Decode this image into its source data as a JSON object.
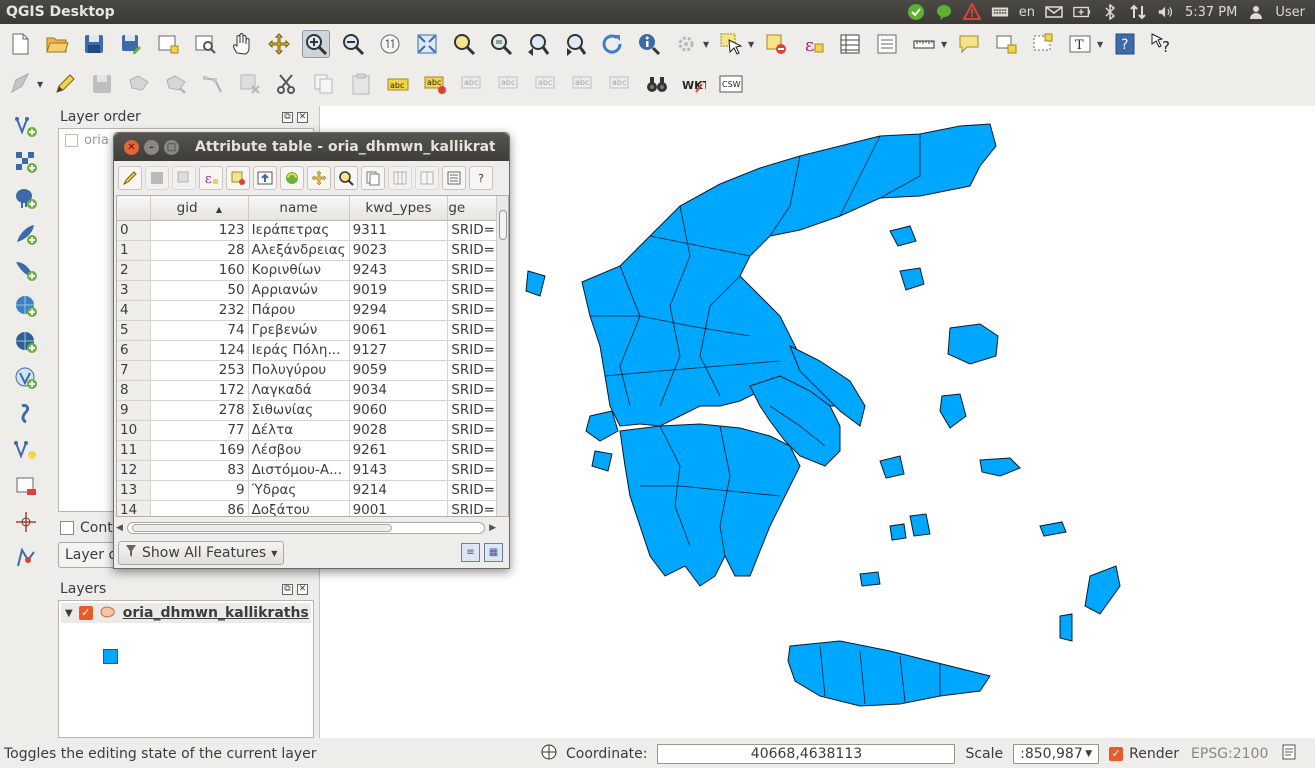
{
  "topbar": {
    "app_title": "QGIS Desktop",
    "keyboard": "en",
    "time": "5:37 PM",
    "user": "User"
  },
  "toolbar": {
    "row1_icons": [
      "new-project-icon",
      "open-project-icon",
      "save-project-icon",
      "save-as-icon",
      "new-print-composer-icon",
      "composer-manager-icon",
      "pan-icon",
      "pan-to-selection-icon",
      "zoom-in-icon",
      "zoom-out-icon",
      "zoom-actual-icon",
      "zoom-full-icon",
      "zoom-to-selection-icon",
      "zoom-to-layer-icon",
      "zoom-last-icon",
      "zoom-next-icon",
      "refresh-icon",
      "identify-icon",
      "action-icon",
      "select-icon",
      "deselect-icon",
      "field-calculator-icon",
      "attribute-table-icon",
      "statistics-icon",
      "measure-icon",
      "annotation-icon",
      "new-text-annotation-icon",
      "form-annotation-icon",
      "label-tool-icon",
      "help-icon",
      "whats-this-icon"
    ],
    "row2_icons": [
      "digitize-icon",
      "toggle-edit-icon",
      "save-edits-icon",
      "add-feature-icon",
      "move-feature-icon",
      "node-tool-icon",
      "delete-selected-icon",
      "cut-features-icon",
      "copy-features-icon",
      "paste-features-icon",
      "label-icon",
      "label-pin-icon",
      "label-highlight-icon",
      "label-show-hide-icon",
      "label-move-icon",
      "label-rotate-icon",
      "label-change-icon",
      "binoculars-icon",
      "wkt-icon",
      "csw-icon"
    ],
    "wkt_text": "WKT",
    "csw_text": "CSW",
    "label_text": "abc"
  },
  "left_toolbar": [
    "add-vector-layer-icon",
    "add-raster-layer-icon",
    "add-postgis-layer-icon",
    "add-spatialite-layer-icon",
    "add-mssql-layer-icon",
    "add-wms-layer-icon",
    "add-wcs-layer-icon",
    "add-wfs-layer-icon",
    "add-delimited-text-icon",
    "new-shapefile-icon",
    "remove-layer-icon",
    "crosshair-icon",
    "georeferencer-icon"
  ],
  "layer_order": {
    "title": "Layer order",
    "partial_item": "oria",
    "control_label": "Cont",
    "button_label": "Layer o"
  },
  "layers": {
    "title": "Layers",
    "layer_name": "oria_dhmwn_kallikraths",
    "fill_color": "#00a7ff"
  },
  "attribute_table": {
    "title": "Attribute table - oria_dhmwn_kallikraths",
    "columns": [
      "gid",
      "name",
      "kwd_ypes",
      "ge"
    ],
    "rows": [
      {
        "n": "0",
        "gid": "123",
        "name": "Ιεράπετρας",
        "kwd": "9311",
        "geom": "SRID="
      },
      {
        "n": "1",
        "gid": "28",
        "name": "Αλεξάνδρειας",
        "kwd": "9023",
        "geom": "SRID="
      },
      {
        "n": "2",
        "gid": "160",
        "name": "Κορινθίων",
        "kwd": "9243",
        "geom": "SRID="
      },
      {
        "n": "3",
        "gid": "50",
        "name": "Αρριανών",
        "kwd": "9019",
        "geom": "SRID="
      },
      {
        "n": "4",
        "gid": "232",
        "name": "Πάρου",
        "kwd": "9294",
        "geom": "SRID="
      },
      {
        "n": "5",
        "gid": "74",
        "name": "Γρεβενών",
        "kwd": "9061",
        "geom": "SRID="
      },
      {
        "n": "6",
        "gid": "124",
        "name": "Ιεράς Πόλη...",
        "kwd": "9127",
        "geom": "SRID="
      },
      {
        "n": "7",
        "gid": "253",
        "name": "Πολυγύρου",
        "kwd": "9059",
        "geom": "SRID="
      },
      {
        "n": "8",
        "gid": "172",
        "name": "Λαγκαδά",
        "kwd": "9034",
        "geom": "SRID="
      },
      {
        "n": "9",
        "gid": "278",
        "name": "Σιθωνίας",
        "kwd": "9060",
        "geom": "SRID="
      },
      {
        "n": "10",
        "gid": "77",
        "name": "Δέλτα",
        "kwd": "9028",
        "geom": "SRID="
      },
      {
        "n": "11",
        "gid": "169",
        "name": "Λέσβου",
        "kwd": "9261",
        "geom": "SRID="
      },
      {
        "n": "12",
        "gid": "83",
        "name": "Διστόμου-Α...",
        "kwd": "9143",
        "geom": "SRID="
      },
      {
        "n": "13",
        "gid": "9",
        "name": "Ύδρας",
        "kwd": "9214",
        "geom": "SRID="
      },
      {
        "n": "14",
        "gid": "86",
        "name": "Δοξάτου",
        "kwd": "9001",
        "geom": "SRID="
      }
    ],
    "show_all": "Show All Features",
    "help": "?"
  },
  "map": {
    "fill": "#00a7ff",
    "stroke": "#0a1a2a"
  },
  "status": {
    "message": "Toggles the editing state of the current layer",
    "coordinate_label": "Coordinate:",
    "coordinate_value": "40668,4638113",
    "scale_label": "Scale",
    "scale_value": ":850,987",
    "render_label": "Render",
    "epsg": "EPSG:2100"
  }
}
